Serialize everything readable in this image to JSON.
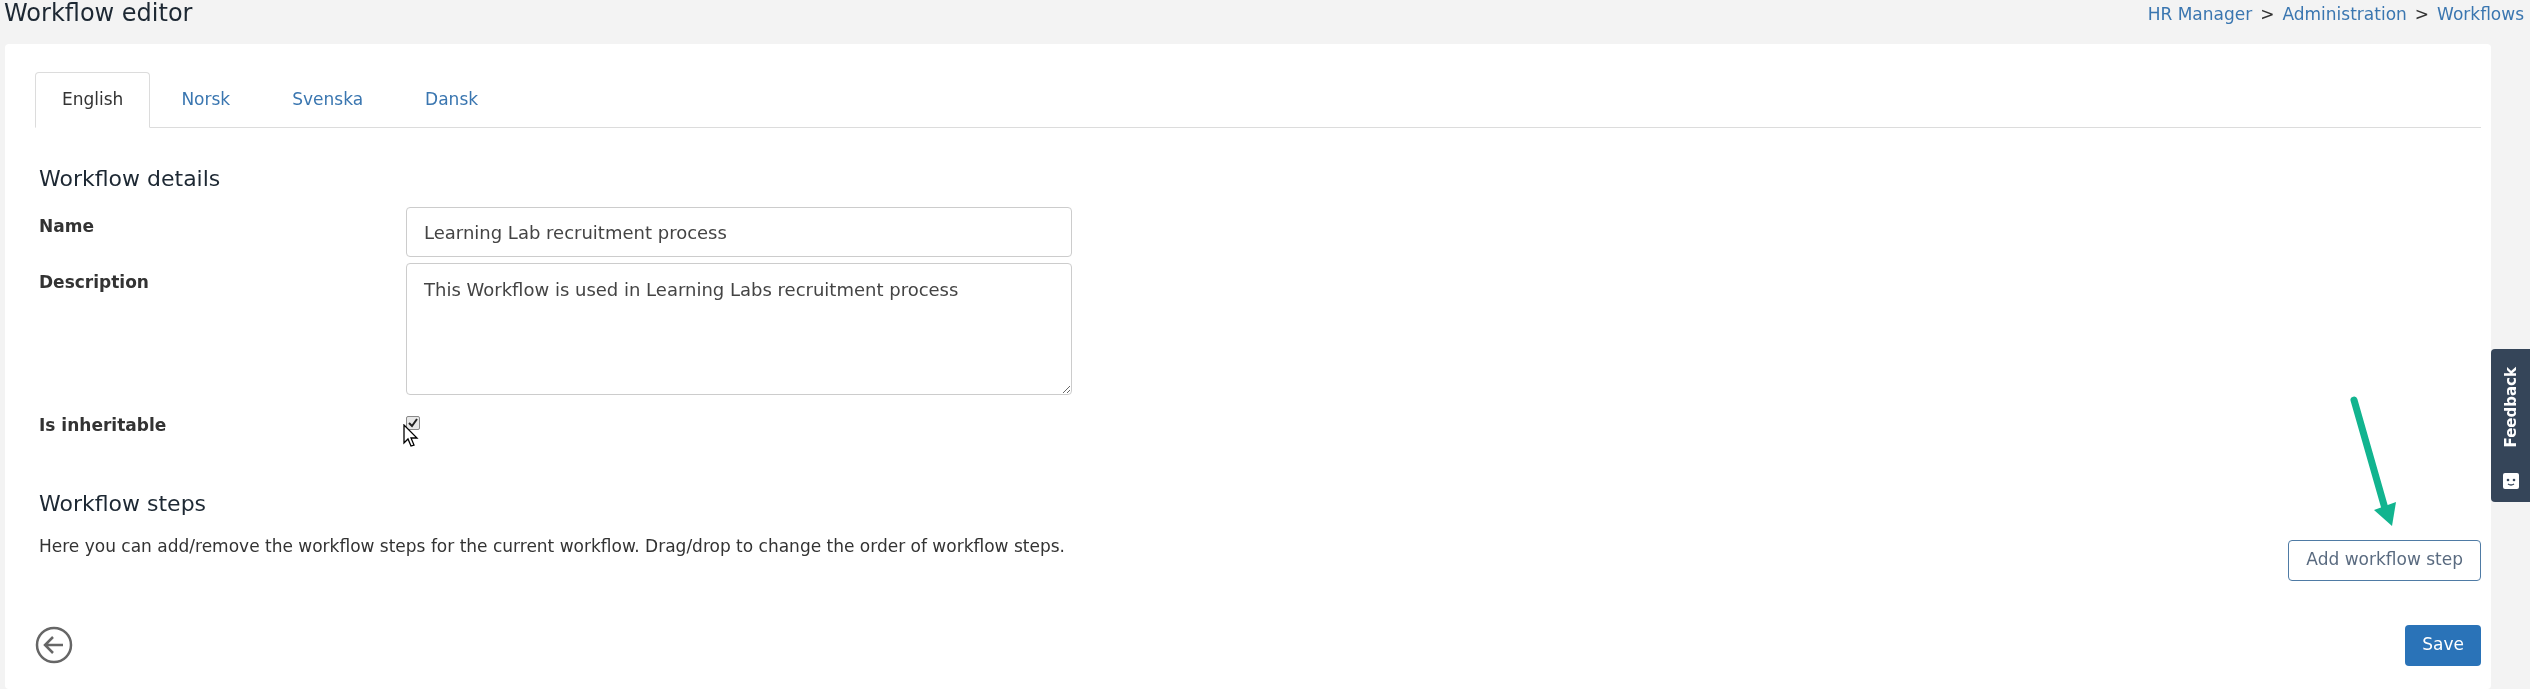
{
  "page": {
    "title": "Workflow editor"
  },
  "breadcrumb": [
    {
      "label": "HR Manager"
    },
    {
      "label": "Administration"
    },
    {
      "label": "Workflows"
    }
  ],
  "breadcrumb_separator": ">",
  "tabs": [
    {
      "label": "English",
      "selected": true
    },
    {
      "label": "Norsk",
      "selected": false
    },
    {
      "label": "Svenska",
      "selected": false
    },
    {
      "label": "Dansk",
      "selected": false
    }
  ],
  "details": {
    "heading": "Workflow details",
    "name": {
      "label": "Name",
      "value": "Learning Lab recruitment process"
    },
    "description": {
      "label": "Description",
      "value": "This Workflow is used in Learning Labs recruitment process"
    },
    "inheritable": {
      "label": "Is inheritable",
      "checked": true
    }
  },
  "steps": {
    "heading": "Workflow steps",
    "text": "Here you can add/remove the workflow steps for the current workflow. Drag/drop to change the order of workflow steps.",
    "add_button": "Add workflow step"
  },
  "save_button": "Save",
  "feedback_tab": {
    "label": "Feedback"
  }
}
